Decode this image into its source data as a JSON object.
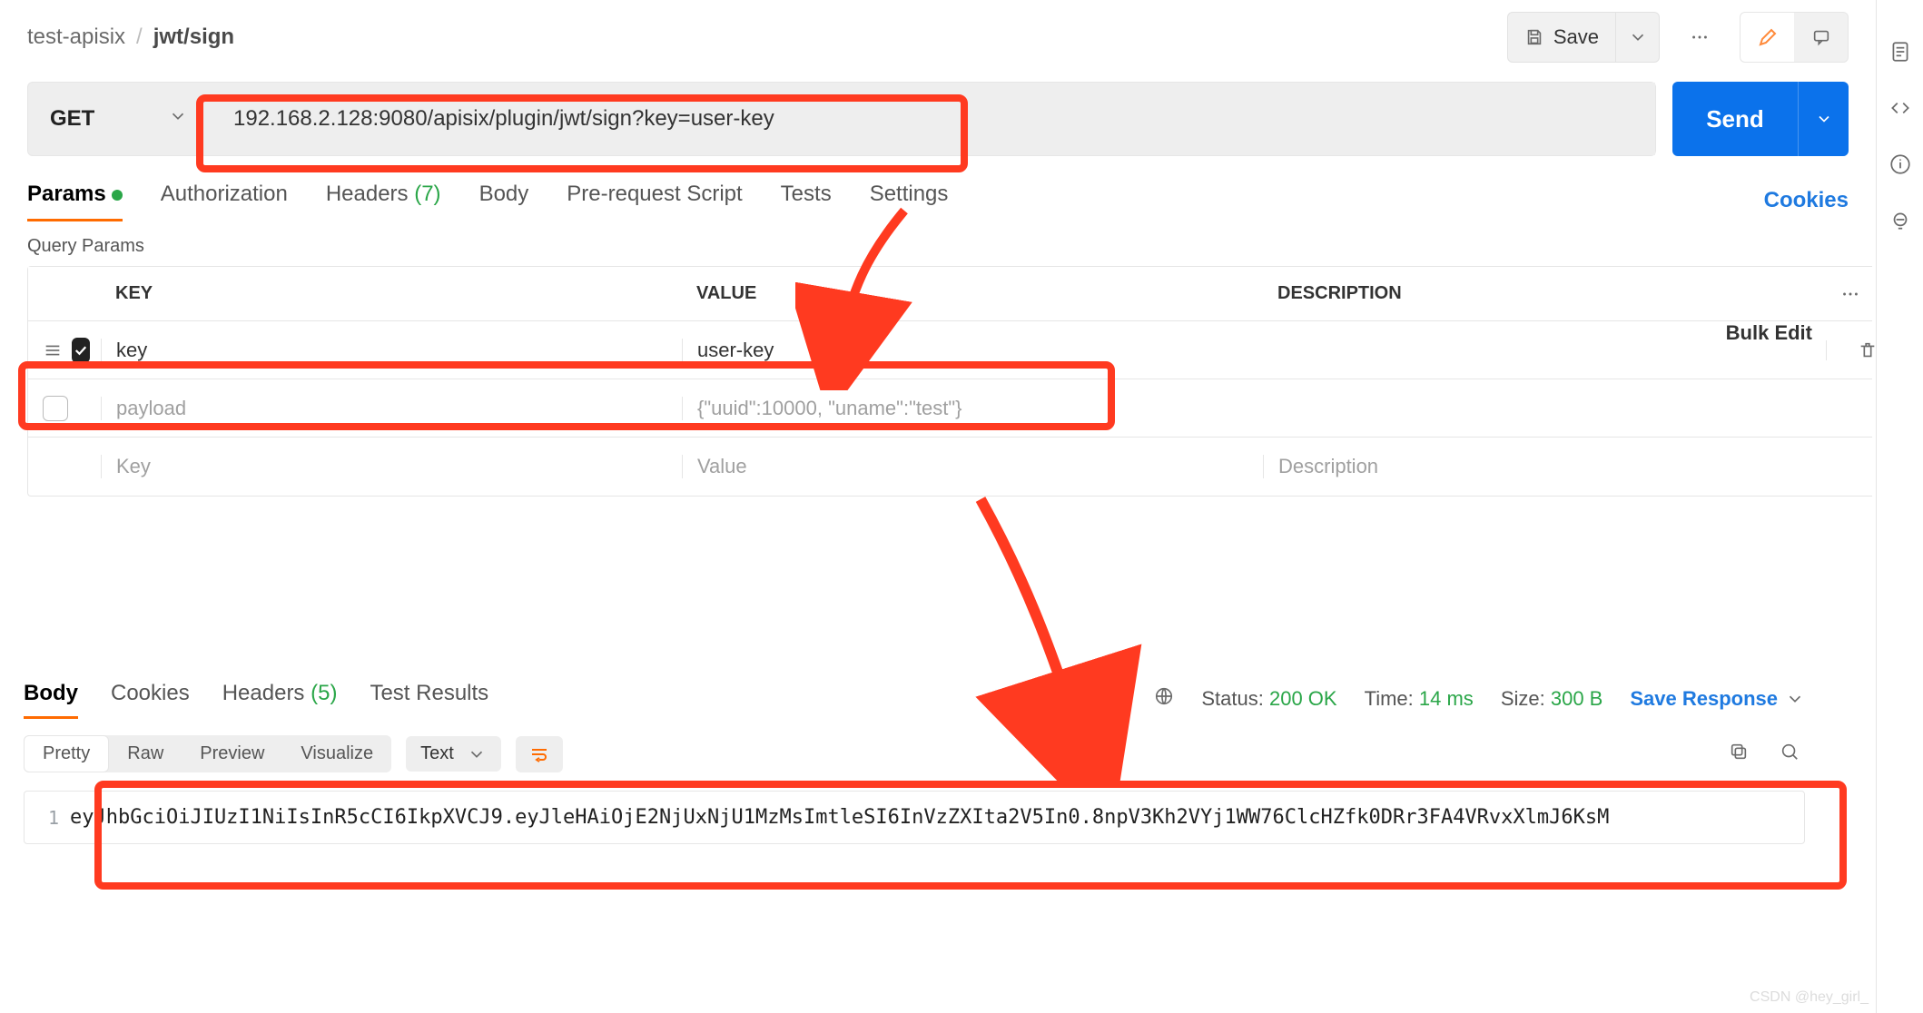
{
  "breadcrumb": {
    "collection": "test-apisix",
    "request": "jwt/sign"
  },
  "topActions": {
    "save_label": "Save"
  },
  "request": {
    "method": "GET",
    "url": "192.168.2.128:9080/apisix/plugin/jwt/sign?key=user-key",
    "send_label": "Send"
  },
  "tabs": {
    "params": "Params",
    "authorization": "Authorization",
    "headers": "Headers",
    "headers_count": "(7)",
    "body": "Body",
    "pre_request": "Pre-request Script",
    "tests": "Tests",
    "settings": "Settings",
    "cookies_link": "Cookies"
  },
  "queryParams": {
    "title": "Query Params",
    "header": {
      "key": "KEY",
      "value": "VALUE",
      "desc": "DESCRIPTION",
      "bulk": "Bulk Edit"
    },
    "rows": [
      {
        "enabled": true,
        "key": "key",
        "value": "user-key",
        "desc": ""
      },
      {
        "enabled": false,
        "key": "payload",
        "value": "{\"uuid\":10000, \"uname\":\"test\"}",
        "desc": ""
      }
    ],
    "placeholders": {
      "key": "Key",
      "value": "Value",
      "desc": "Description"
    }
  },
  "response": {
    "tabs": {
      "body": "Body",
      "cookies": "Cookies",
      "headers": "Headers",
      "headers_count": "(5)",
      "test_results": "Test Results"
    },
    "status_label": "Status:",
    "status_value": "200 OK",
    "time_label": "Time:",
    "time_value": "14 ms",
    "size_label": "Size:",
    "size_value": "300 B",
    "save_label": "Save Response",
    "format": {
      "pretty": "Pretty",
      "raw": "Raw",
      "preview": "Preview",
      "visualize": "Visualize",
      "type": "Text"
    },
    "body_lines": [
      "eyJhbGciOiJIUzI1NiIsInR5cCI6IkpXVCJ9.eyJleHAiOjE2NjUxNjU1MzMsImtleSI6InVzZXIta2V5In0.8npV3Kh2VYj1WW76ClcHZfk0DRr3FA4VRvxXlmJ6KsM"
    ]
  },
  "watermark": "CSDN @hey_girl_"
}
